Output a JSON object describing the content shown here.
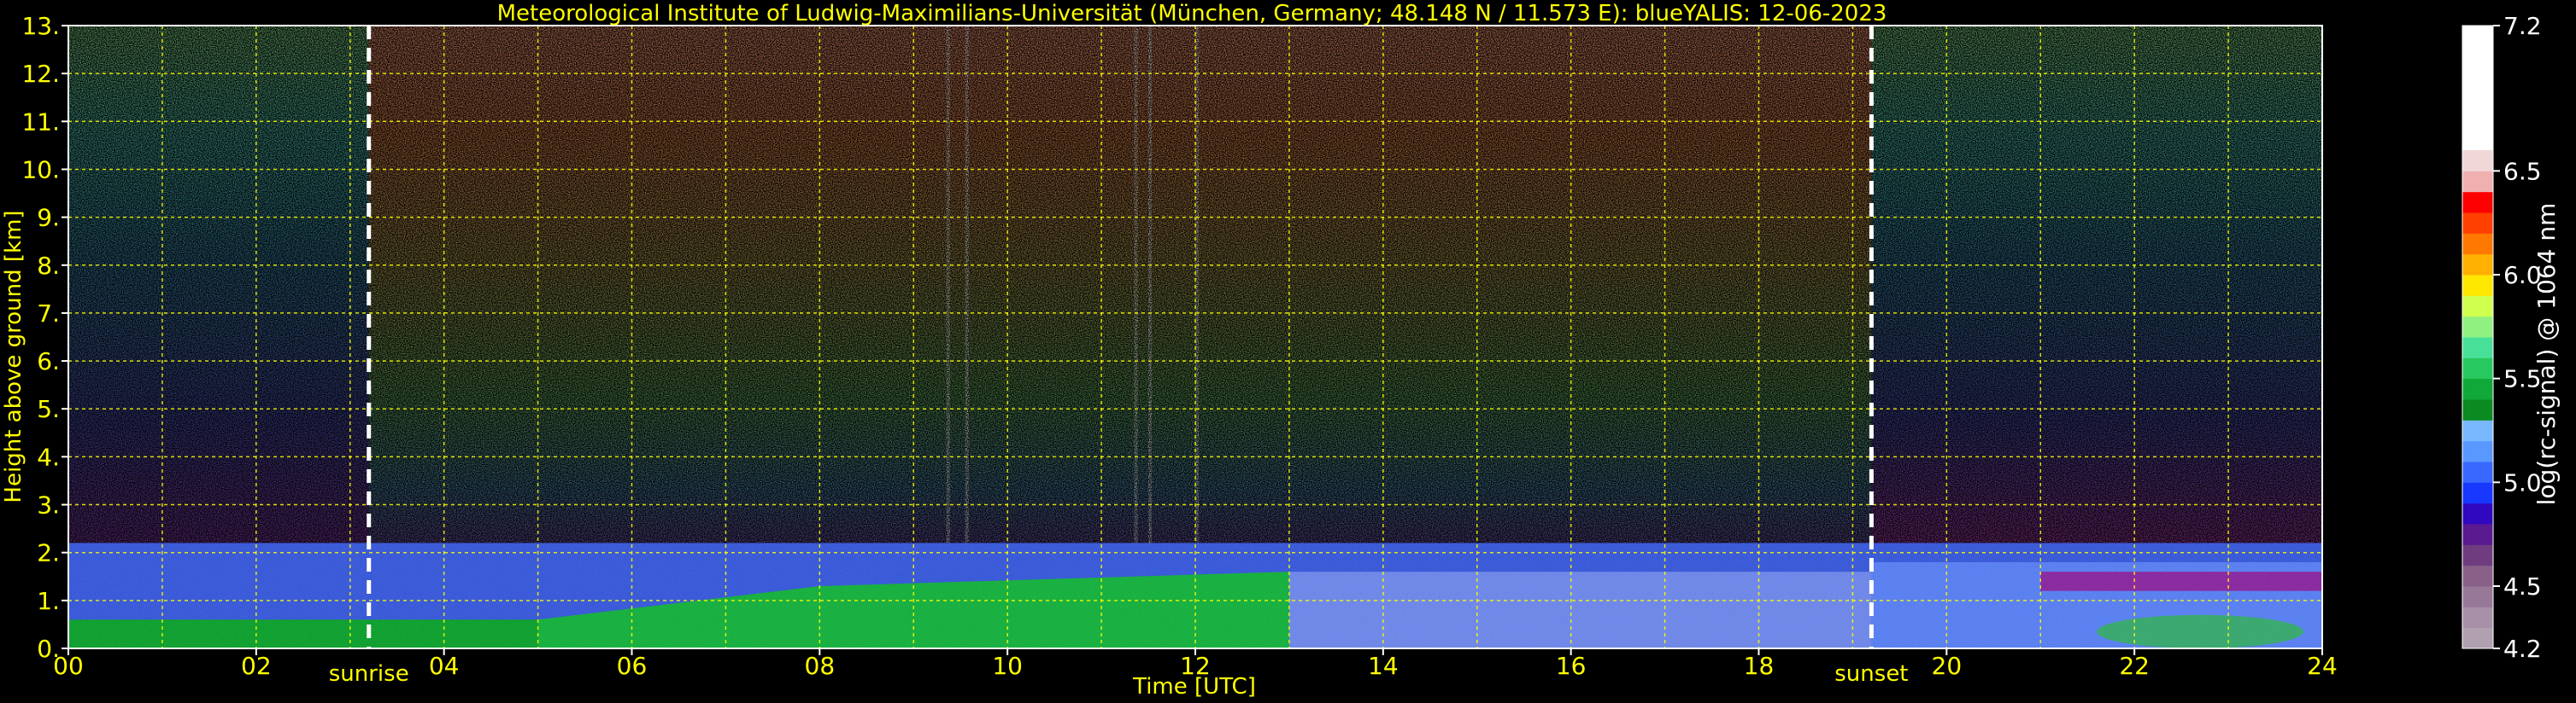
{
  "chart_data": {
    "type": "heatmap",
    "title": "Meteorological Institute of Ludwig-Maximilians-Universität (München, Germany; 48.148 N / 11.573 E):    blueYALIS: 12-06-2023",
    "xlabel": "Time [UTC]",
    "ylabel": "Height above ground [km]",
    "xlim": [
      0,
      24
    ],
    "ylim": [
      0,
      13
    ],
    "x_ticks": [
      "00",
      "02",
      "04",
      "06",
      "08",
      "10",
      "12",
      "14",
      "16",
      "18",
      "20",
      "22",
      "24"
    ],
    "y_ticks": [
      "0.",
      "1.",
      "2.",
      "3.",
      "4.",
      "5.",
      "6.",
      "7.",
      "8.",
      "9.",
      "10.",
      "11.",
      "12.",
      "13."
    ],
    "grid": true,
    "annotations": [
      {
        "text": "sunrise",
        "x": 3.2
      },
      {
        "text": "sunset",
        "x": 19.2
      }
    ],
    "colorbar": {
      "label": "log(rc-signal) @ 1064 nm",
      "range": [
        4.2,
        7.2
      ],
      "ticks": [
        "4.2",
        "4.5",
        "5.0",
        "5.5",
        "6.0",
        "6.5",
        "7.2"
      ],
      "colors": [
        "#b0a0b0",
        "#a890a8",
        "#987898",
        "#886088",
        "#703c80",
        "#5a1a90",
        "#3008c0",
        "#1838ff",
        "#3868ff",
        "#5898ff",
        "#78b8ff",
        "#0a8a20",
        "#10a838",
        "#28c860",
        "#48e098",
        "#90f080",
        "#d0ff50",
        "#ffe800",
        "#ffb000",
        "#ff7800",
        "#ff4000",
        "#ff0000",
        "#f0b0b0",
        "#f0d8d8",
        "#ffffff"
      ]
    }
  }
}
